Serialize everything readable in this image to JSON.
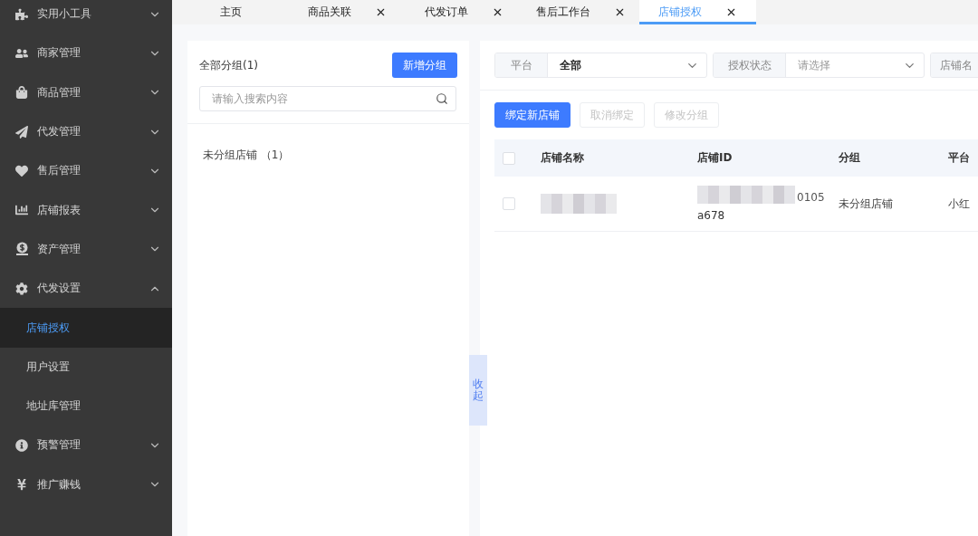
{
  "sidebar": {
    "items": [
      {
        "label": "实用小工具",
        "expanded": false
      },
      {
        "label": "商家管理",
        "expanded": false
      },
      {
        "label": "商品管理",
        "expanded": false
      },
      {
        "label": "代发管理",
        "expanded": false
      },
      {
        "label": "售后管理",
        "expanded": false
      },
      {
        "label": "店铺报表",
        "expanded": false
      },
      {
        "label": "资产管理",
        "expanded": false
      },
      {
        "label": "代发设置",
        "expanded": true,
        "children": [
          {
            "label": "店铺授权",
            "selected": true
          },
          {
            "label": "用户设置",
            "selected": false
          },
          {
            "label": "地址库管理",
            "selected": false
          }
        ]
      },
      {
        "label": "预警管理",
        "expanded": false
      },
      {
        "label": "推广赚钱",
        "expanded": false
      }
    ]
  },
  "tabs": [
    {
      "label": "主页",
      "closable": false,
      "selected": false
    },
    {
      "label": "商品关联",
      "closable": true,
      "selected": false
    },
    {
      "label": "代发订单",
      "closable": true,
      "selected": false
    },
    {
      "label": "售后工作台",
      "closable": true,
      "selected": false
    },
    {
      "label": "店铺授权",
      "closable": true,
      "selected": true
    }
  ],
  "groups_panel": {
    "title": "全部分组(1)",
    "add_button": "新增分组",
    "search": {
      "placeholder": "请输入搜索内容"
    },
    "groups": [
      {
        "label": "未分组店铺 （1）"
      }
    ],
    "collapse_handle": "收起"
  },
  "filters": [
    {
      "label": "平台",
      "value": "全部"
    },
    {
      "label": "授权状态",
      "placeholder": "请选择"
    },
    {
      "label": "店铺名"
    }
  ],
  "actions": [
    {
      "label": "绑定新店铺",
      "disabled": false
    },
    {
      "label": "取消绑定",
      "disabled": true
    },
    {
      "label": "修改分组",
      "disabled": true
    }
  ],
  "table": {
    "all_checked": false,
    "columns": [
      "店铺名称",
      "店铺ID",
      "分组",
      "平台"
    ],
    "rows": [
      {
        "checked": false,
        "id_lines": [
          "0105",
          "a678"
        ],
        "group": "未分组店铺",
        "platform": "小红"
      }
    ]
  }
}
